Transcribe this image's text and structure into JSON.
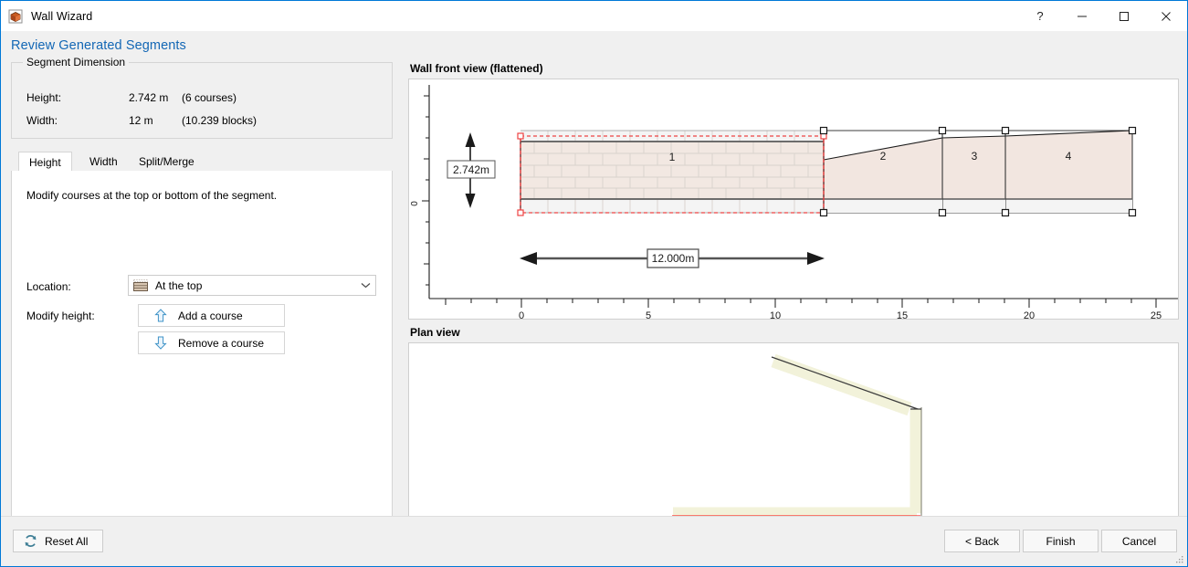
{
  "window": {
    "title": "Wall Wizard",
    "icon": "app-brick-icon",
    "controls": {
      "help": "?",
      "minimize": "minimize-icon",
      "maximize": "maximize-icon",
      "close": "close-icon"
    }
  },
  "page": {
    "title": "Review Generated Segments"
  },
  "segment_dimension": {
    "group_title": "Segment Dimension",
    "rows": [
      {
        "label": "Height:",
        "value": "2.742 m",
        "note": "(6 courses)"
      },
      {
        "label": "Width:",
        "value": "12 m",
        "note": "(10.239 blocks)"
      }
    ]
  },
  "tabs": [
    {
      "label": "Height",
      "active": true
    },
    {
      "label": "Width",
      "active": false
    },
    {
      "label": "Split/Merge",
      "active": false
    }
  ],
  "height_tab": {
    "hint": "Modify courses at the top or bottom of the segment.",
    "location_label": "Location:",
    "location_value": "At the top",
    "location_icon": "brick-course-icon",
    "modify_label": "Modify height:",
    "add_button": "Add a course",
    "add_icon": "arrow-up-icon",
    "remove_button": "Remove a course",
    "remove_icon": "arrow-down-icon"
  },
  "front_view": {
    "label": "Wall front view (flattened)",
    "height_dim_label": "2.742m",
    "width_dim_label": "12.000m"
  },
  "plan_view": {
    "label": "Plan view"
  },
  "footer": {
    "reset": "Reset All",
    "reset_icon": "refresh-icon",
    "back": "< Back",
    "finish": "Finish",
    "cancel": "Cancel"
  },
  "colors": {
    "accent": "#1367b5",
    "window_border": "#0078d7",
    "brick_fill": "#f2e8e2",
    "segment_fill": "#f2e6e0",
    "selection_red": "#ee4444",
    "plan_wall": "#f2f2da",
    "plan_highlight": "#ff0000"
  },
  "chart_data": {
    "type": "line",
    "title": "Wall front view (flattened)",
    "xlabel": "",
    "ylabel": "",
    "xlim": [
      -1.8,
      26.2
    ],
    "ylim": [
      -1.6,
      4.6
    ],
    "grid": false,
    "legend": null,
    "x_ticks": [
      0,
      5,
      10,
      15,
      20,
      25
    ],
    "x_tick_labels": [
      "0",
      "5",
      "10",
      "15",
      "20",
      "25"
    ],
    "x_minor_ticks": [
      -1,
      1,
      2,
      3,
      4,
      6,
      7,
      8,
      9,
      11,
      12,
      13,
      14,
      16,
      17,
      18,
      19,
      21,
      22,
      23,
      24,
      26
    ],
    "y_ticks": [
      0
    ],
    "y_tick_labels": [
      "0"
    ],
    "y_minor_ticks": [
      -1.5,
      -1.0,
      -0.5,
      0.5,
      1.0,
      1.5,
      2.0,
      2.5,
      3.0,
      3.5,
      4.0
    ],
    "segments": [
      {
        "id": "1",
        "x_start": 0.0,
        "x_end": 12.0,
        "top_left": 2.742,
        "top_right": 2.742,
        "bottom": 0.0,
        "brick": true,
        "label": "1"
      },
      {
        "id": "2",
        "x_start": 12.0,
        "x_end": 17.0,
        "top_left": 2.742,
        "top_right": 3.25,
        "bottom": 0.0,
        "brick": false,
        "label": "2"
      },
      {
        "id": "3",
        "x_start": 17.0,
        "x_end": 19.5,
        "top_left": 3.25,
        "top_right": 3.36,
        "bottom": 0.0,
        "brick": false,
        "label": "3"
      },
      {
        "id": "4",
        "x_start": 19.5,
        "x_end": 24.5,
        "top_left": 3.36,
        "top_right": 3.55,
        "bottom": 0.0,
        "brick": false,
        "label": "4"
      }
    ],
    "annotations": [
      {
        "kind": "vertical-dimension",
        "text": "2.742m",
        "from": 0.0,
        "to": 2.742,
        "at_x": -0.9
      },
      {
        "kind": "horizontal-dimension",
        "text": "12.000m",
        "from": 0.0,
        "to": 12.0,
        "at_y": -0.95
      }
    ],
    "selection": {
      "segment": "1",
      "style": "red-dashed",
      "handles": 4
    },
    "courses": 6,
    "blocks_per_course": 11
  },
  "plan_data": {
    "type": "line",
    "title": "Plan view",
    "paths": [
      {
        "name": "wall-diagonal",
        "points": [
          [
            397,
            22
          ],
          [
            560,
            78
          ]
        ]
      },
      {
        "name": "wall-vertical",
        "points": [
          [
            560,
            78
          ],
          [
            560,
            188
          ]
        ]
      },
      {
        "name": "wall-horizontal",
        "points": [
          [
            560,
            188
          ],
          [
            288,
            188
          ]
        ]
      }
    ],
    "highlight_path": {
      "name": "selected-segment",
      "points": [
        [
          288,
          192
        ],
        [
          560,
          192
        ]
      ]
    }
  }
}
